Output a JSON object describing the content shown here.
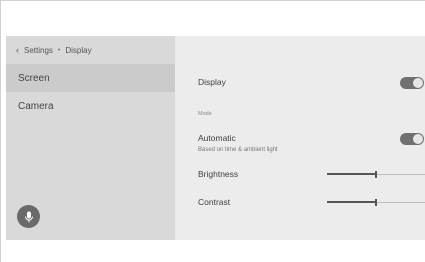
{
  "breadcrumb": {
    "back_icon": "chevron-left-icon",
    "parent": "Settings",
    "separator": "•",
    "current": "Display"
  },
  "sidebar": {
    "items": [
      {
        "label": "Screen",
        "active": true
      },
      {
        "label": "Camera",
        "active": false
      }
    ],
    "mic_icon": "microphone-icon"
  },
  "main": {
    "display": {
      "label": "Display",
      "toggle_on": true
    },
    "section_mode": "Mode",
    "automatic": {
      "label": "Automatic",
      "sublabel": "Based on time & ambient light",
      "toggle_on": true
    },
    "brightness": {
      "label": "Brightness",
      "level": 0.5
    },
    "contrast": {
      "label": "Contrast",
      "level": 0.5
    }
  }
}
